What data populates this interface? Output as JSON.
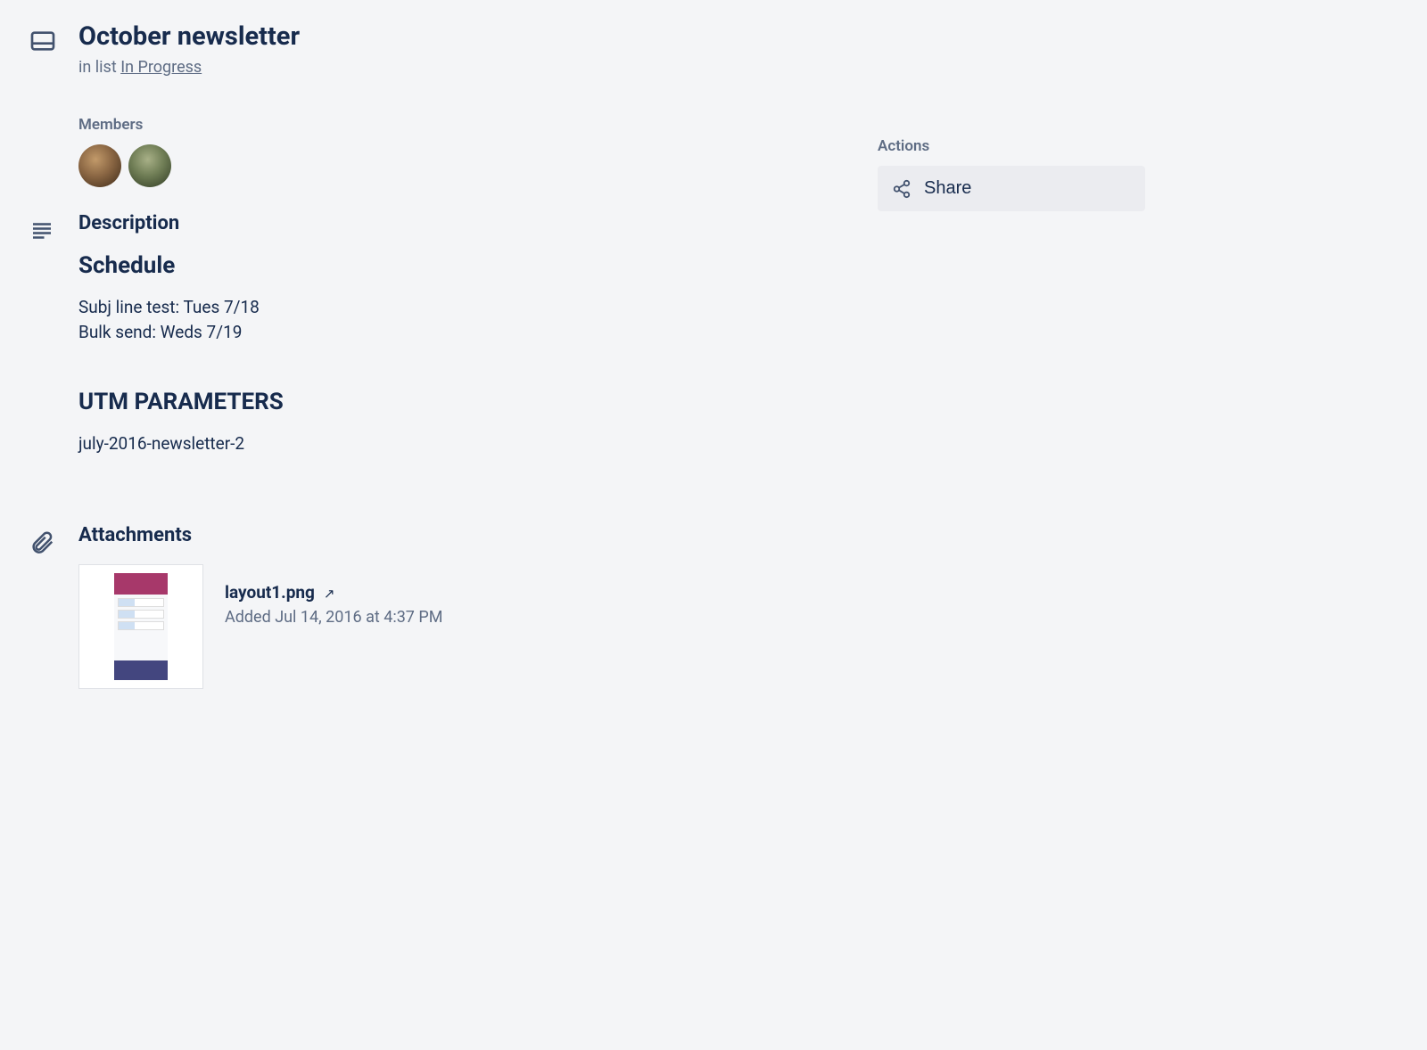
{
  "header": {
    "title": "October newsletter",
    "in_list_prefix": "in list ",
    "in_list_name": "In Progress"
  },
  "members": {
    "label": "Members"
  },
  "description": {
    "section_title": "Description",
    "blocks": [
      {
        "heading": "Schedule",
        "lines": [
          "Subj line test: Tues 7/18",
          "Bulk send: Weds 7/19"
        ]
      },
      {
        "heading": "UTM PARAMETERS",
        "lines": [
          "july-2016-newsletter-2"
        ]
      }
    ]
  },
  "attachments": {
    "section_title": "Attachments",
    "items": [
      {
        "name": "layout1.png",
        "meta": "Added Jul 14, 2016 at 4:37 PM"
      }
    ]
  },
  "actions": {
    "label": "Actions",
    "share": "Share"
  }
}
